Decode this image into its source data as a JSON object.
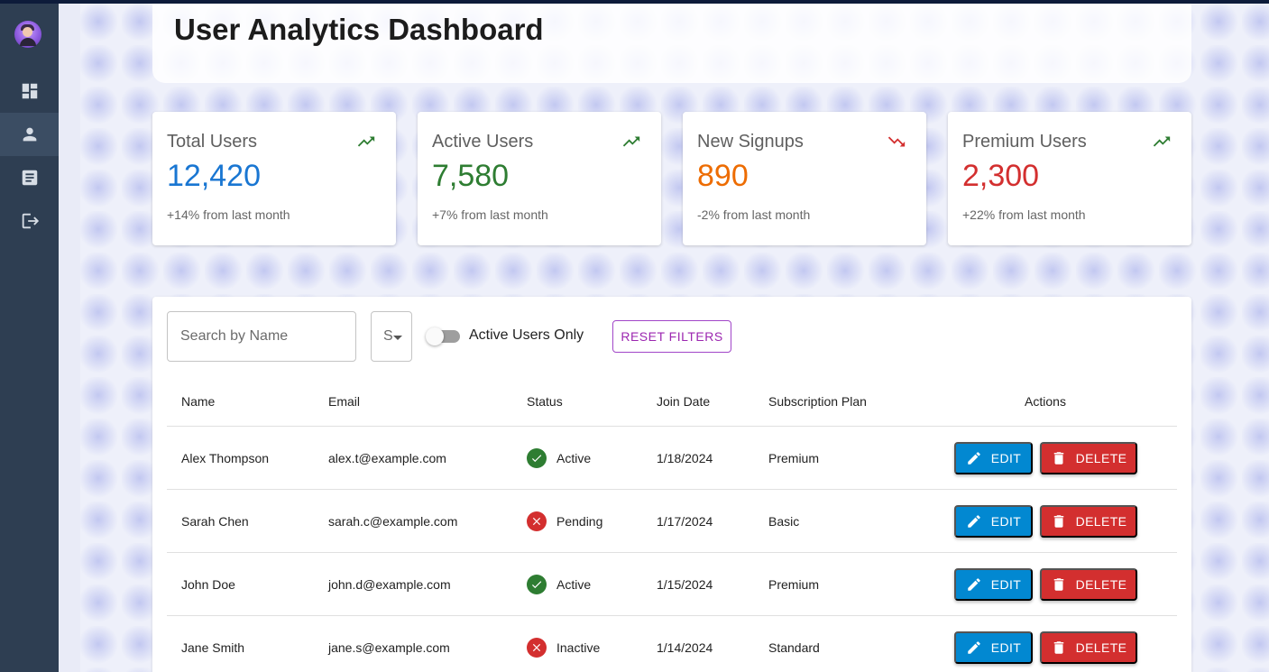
{
  "header": {
    "title": "User Analytics Dashboard"
  },
  "sidebar": {
    "items": [
      {
        "name": "dashboard",
        "icon": "dashboard-icon",
        "active": false
      },
      {
        "name": "users",
        "icon": "person-icon",
        "active": true
      },
      {
        "name": "reports",
        "icon": "article-icon",
        "active": false
      },
      {
        "name": "logout",
        "icon": "logout-icon",
        "active": false
      }
    ]
  },
  "stats": [
    {
      "title": "Total Users",
      "value": "12,420",
      "change": "+14% from last month",
      "trend": "up",
      "color": "#1976d2"
    },
    {
      "title": "Active Users",
      "value": "7,580",
      "change": "+7% from last month",
      "trend": "up",
      "color": "#2e7d32"
    },
    {
      "title": "New Signups",
      "value": "890",
      "change": "-2% from last month",
      "trend": "down",
      "color": "#ed6c02"
    },
    {
      "title": "Premium Users",
      "value": "2,300",
      "change": "+22% from last month",
      "trend": "up",
      "color": "#d32f2f"
    }
  ],
  "filters": {
    "search_placeholder": "Search by Name",
    "status_label": "S",
    "active_only_label": "Active Users Only",
    "active_only_on": false,
    "reset_label": "RESET FILTERS"
  },
  "table": {
    "columns": [
      "Name",
      "Email",
      "Status",
      "Join Date",
      "Subscription Plan",
      "Actions"
    ],
    "edit_label": "EDIT",
    "delete_label": "DELETE",
    "rows": [
      {
        "name": "Alex Thompson",
        "email": "alex.t@example.com",
        "status": "Active",
        "join_date": "1/18/2024",
        "plan": "Premium"
      },
      {
        "name": "Sarah Chen",
        "email": "sarah.c@example.com",
        "status": "Pending",
        "join_date": "1/17/2024",
        "plan": "Basic"
      },
      {
        "name": "John Doe",
        "email": "john.d@example.com",
        "status": "Active",
        "join_date": "1/15/2024",
        "plan": "Premium"
      },
      {
        "name": "Jane Smith",
        "email": "jane.s@example.com",
        "status": "Inactive",
        "join_date": "1/14/2024",
        "plan": "Standard"
      }
    ]
  },
  "colors": {
    "sidebar": "#2e3e52",
    "success": "#2e7d32",
    "error": "#d32f2f",
    "edit": "#0288d1",
    "reset": "#9c27b0"
  }
}
